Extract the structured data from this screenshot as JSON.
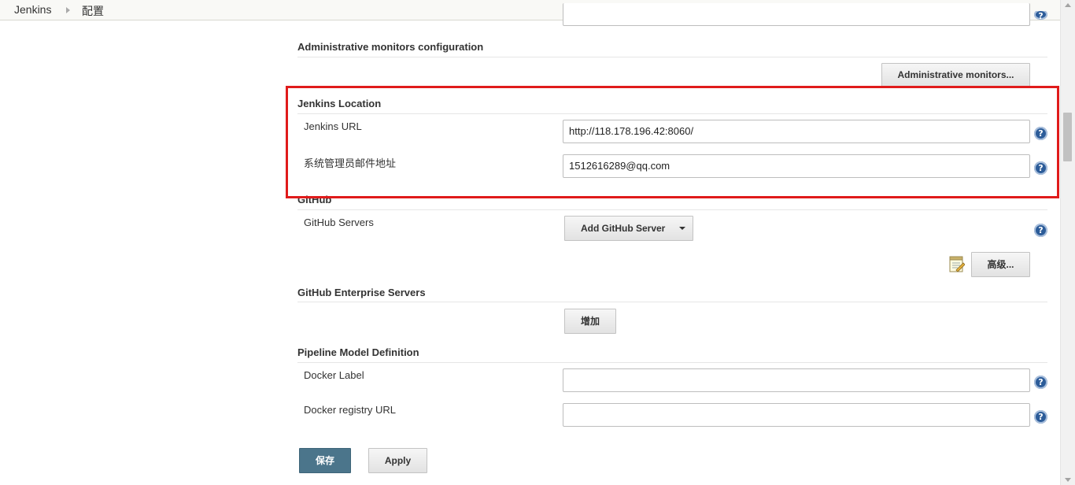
{
  "breadcrumb": {
    "root": "Jenkins",
    "current": "配置"
  },
  "sections": {
    "admin_monitors": {
      "title": "Administrative monitors configuration",
      "button": "Administrative monitors..."
    },
    "jenkins_location": {
      "title": "Jenkins Location",
      "url_label": "Jenkins URL",
      "url_value": "http://118.178.196.42:8060/",
      "email_label": "系统管理员邮件地址",
      "email_value": "1512616289@qq.com"
    },
    "github": {
      "title": "GitHub",
      "servers_label": "GitHub Servers",
      "add_button": "Add GitHub Server",
      "advanced_button": "高级..."
    },
    "github_enterprise": {
      "title": "GitHub Enterprise Servers",
      "add_button": "增加"
    },
    "pipeline": {
      "title": "Pipeline Model Definition",
      "docker_label": "Docker Label",
      "docker_label_value": "",
      "registry_label": "Docker registry URL",
      "registry_value": ""
    }
  },
  "footer": {
    "save": "保存",
    "apply": "Apply"
  },
  "help_glyph": "?",
  "colors": {
    "highlight": "#e01b1b",
    "primary_button": "#4b758b",
    "help_icon": "#2c5c99"
  }
}
